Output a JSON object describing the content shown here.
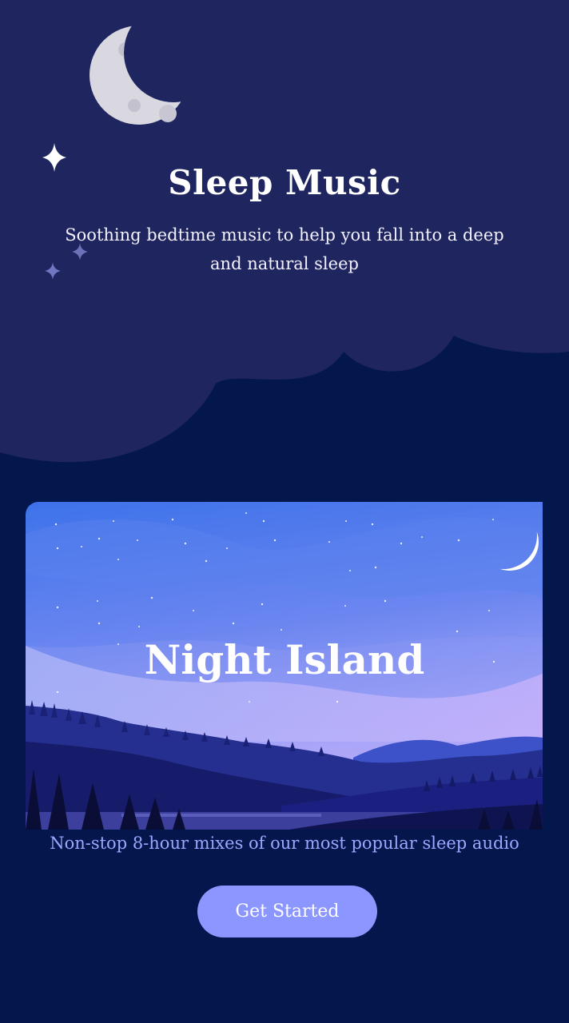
{
  "header": {
    "title": "Sleep Music",
    "subtitle": "Soothing bedtime music to help you fall into a deep and natural sleep"
  },
  "card": {
    "title": "Night Island"
  },
  "tagline": "Non-stop 8-hour mixes of our most popular sleep audio",
  "cta": {
    "label": "Get Started"
  },
  "colors": {
    "background": "#03174c",
    "cloud": "#1f255e",
    "accent": "#8c96ff",
    "tagline": "#9fa6ff"
  },
  "icons": [
    "moon-icon",
    "sparkle-icon",
    "crescent-moon-icon"
  ]
}
